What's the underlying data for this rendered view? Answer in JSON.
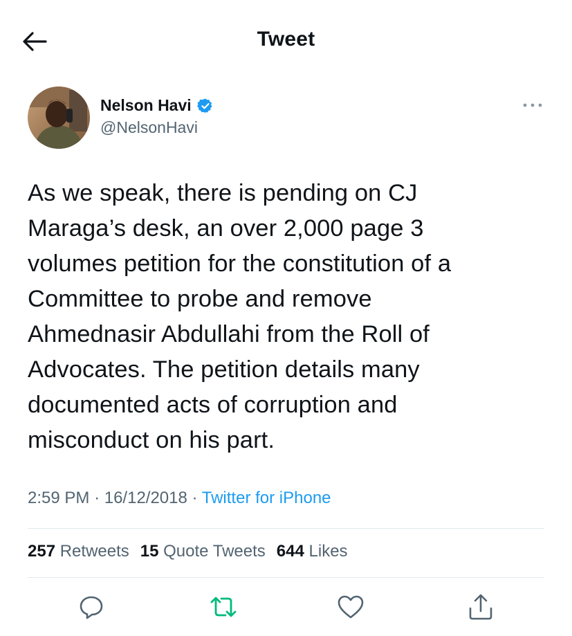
{
  "header": {
    "title": "Tweet",
    "back_icon": "arrow-left-icon"
  },
  "author": {
    "name": "Nelson Havi",
    "handle": "@NelsonHavi",
    "verified_icon": "verified-badge-icon"
  },
  "tweet": {
    "text_lines": [
      "As we speak, there is pending on CJ",
      "Maraga’s desk, an over 2,000 page 3",
      "volumes petition for the constitution of a",
      "Committee to probe and remove",
      "Ahmednasir Abdullahi from the Roll of",
      "Advocates. The petition details many",
      "documented acts of corruption and",
      "misconduct on his part."
    ],
    "time": "2:59 PM",
    "date": "16/12/2018",
    "source": "Twitter for iPhone",
    "separator": "·"
  },
  "stats": {
    "retweets_count": "257",
    "retweets_label": "Retweets",
    "quotes_count": "15",
    "quotes_label": "Quote Tweets",
    "likes_count": "644",
    "likes_label": "Likes"
  },
  "actions": {
    "reply_icon": "reply-icon",
    "retweet_icon": "retweet-icon",
    "like_icon": "heart-icon",
    "share_icon": "share-icon"
  },
  "colors": {
    "text_primary": "#0f1419",
    "text_secondary": "#536471",
    "accent_blue": "#1d9bf0",
    "retweet_green": "#00ba7c",
    "divider": "#e1e8ed"
  }
}
